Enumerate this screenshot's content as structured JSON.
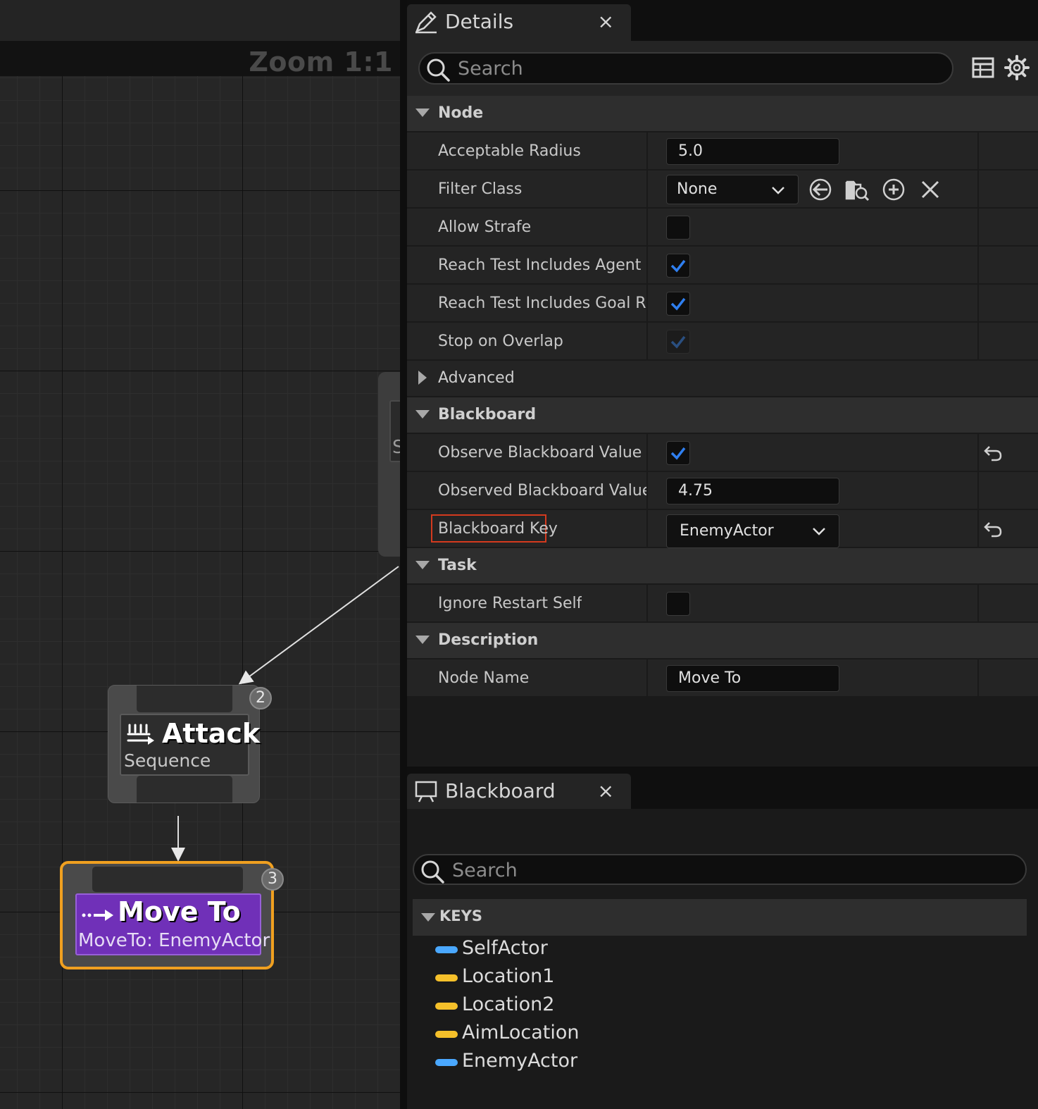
{
  "graph": {
    "zoom_label": "Zoom 1:1",
    "parent_node_fragment": "S",
    "attack_node": {
      "title": "Attack",
      "subtitle": "Sequence",
      "index": "2"
    },
    "moveto_node": {
      "title": "Move To",
      "subtitle": "MoveTo: EnemyActor",
      "index": "3",
      "selected_color": "#f0a020",
      "body_color": "#7030b8"
    }
  },
  "details": {
    "tab_title": "Details",
    "close_glyph": "×",
    "search_placeholder": "Search",
    "sections": {
      "node": "Node",
      "advanced": "Advanced",
      "blackboard": "Blackboard",
      "task": "Task",
      "description": "Description"
    },
    "properties": {
      "acceptable_radius": {
        "label": "Acceptable Radius",
        "value": "5.0"
      },
      "filter_class": {
        "label": "Filter Class",
        "value": "None"
      },
      "allow_strafe": {
        "label": "Allow Strafe",
        "checked": false
      },
      "reach_agent": {
        "label": "Reach Test Includes Agent Ra...",
        "checked": true
      },
      "reach_goal": {
        "label": "Reach Test Includes Goal Radi...",
        "checked": true
      },
      "stop_on_overlap": {
        "label": "Stop on Overlap",
        "checked": true,
        "disabled": true
      },
      "observe_bb_value": {
        "label": "Observe Blackboard Value",
        "checked": true
      },
      "observed_bb_tolerance": {
        "label": "Observed Blackboard Value T...",
        "value": "4.75"
      },
      "blackboard_key": {
        "label": "Blackboard Key",
        "value": "EnemyActor"
      },
      "ignore_restart_self": {
        "label": "Ignore Restart Self",
        "checked": false
      },
      "node_name": {
        "label": "Node Name",
        "value": "Move To"
      }
    },
    "check_color": "#2f7ff0",
    "highlight_color": "#d43a1e"
  },
  "blackboard": {
    "tab_title": "Blackboard",
    "close_glyph": "×",
    "search_placeholder": "Search",
    "keys_header": "KEYS",
    "keys": [
      {
        "name": "SelfActor",
        "color": "#4aa8ff"
      },
      {
        "name": "Location1",
        "color": "#f5c02a"
      },
      {
        "name": "Location2",
        "color": "#f5c02a"
      },
      {
        "name": "AimLocation",
        "color": "#f5c02a"
      },
      {
        "name": "EnemyActor",
        "color": "#4aa8ff"
      }
    ]
  }
}
